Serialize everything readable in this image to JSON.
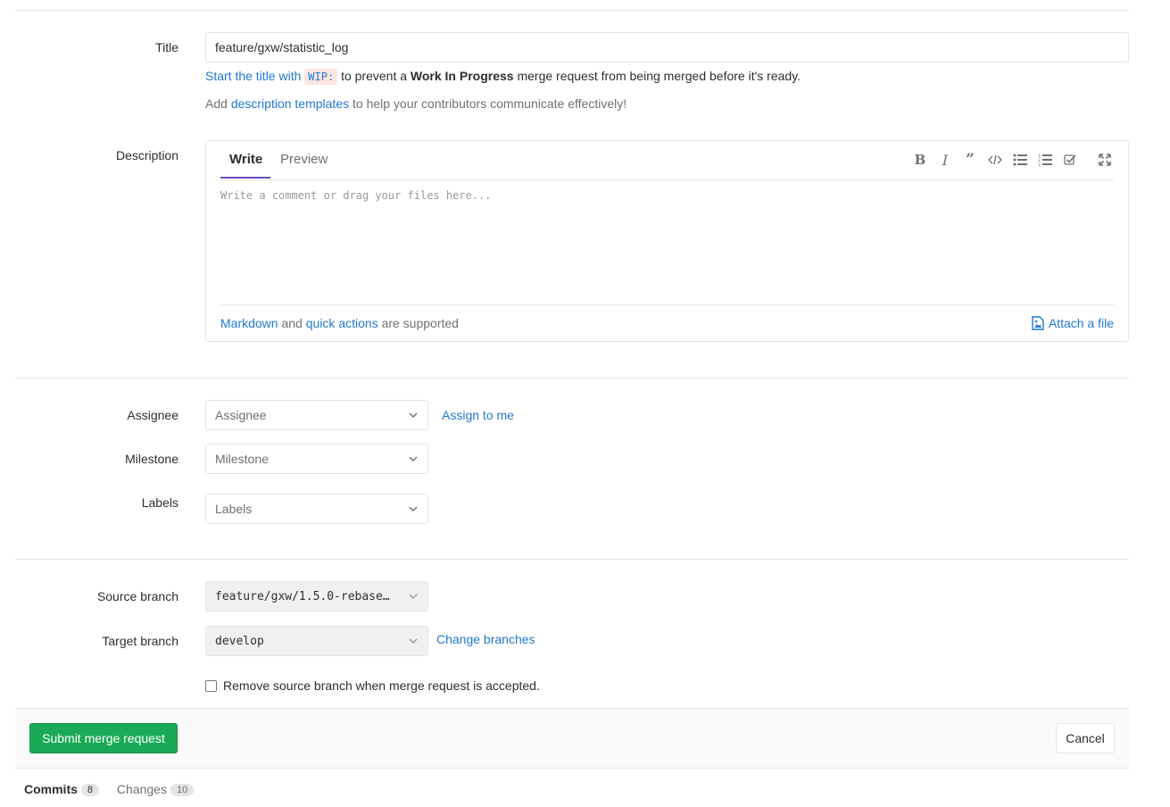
{
  "title_field": {
    "label": "Title",
    "value": "feature/gxw/statistic_log"
  },
  "wip_hint": {
    "prefix_link": "Start the title with",
    "code": "WIP:",
    "middle": "to prevent a",
    "bold": "Work In Progress",
    "suffix": "merge request from being merged before it's ready."
  },
  "template_hint": {
    "prefix": "Add",
    "link": "description templates",
    "suffix": "to help your contributors communicate effectively!"
  },
  "description": {
    "label": "Description",
    "tabs": [
      "Write",
      "Preview"
    ],
    "placeholder": "Write a comment or drag your files here...",
    "footer_link1": "Markdown",
    "footer_and": "and",
    "footer_link2": "quick actions",
    "footer_suffix": "are supported",
    "attach_label": "Attach a file",
    "toolbar": [
      "bold-icon",
      "italic-icon",
      "quote-icon",
      "code-icon",
      "bullet-list-icon",
      "numbered-list-icon",
      "task-list-icon",
      "fullscreen-icon"
    ]
  },
  "assignee": {
    "label": "Assignee",
    "value": "Assignee",
    "assign_link": "Assign to me"
  },
  "milestone": {
    "label": "Milestone",
    "value": "Milestone"
  },
  "labels": {
    "label": "Labels",
    "value": "Labels"
  },
  "source_branch": {
    "label": "Source branch",
    "value": "feature/gxw/1.5.0-rebase…"
  },
  "target_branch": {
    "label": "Target branch",
    "value": "develop",
    "change_link": "Change branches"
  },
  "remove_branch": {
    "label": "Remove source branch when merge request is accepted.",
    "checked": false
  },
  "actions": {
    "submit": "Submit merge request",
    "cancel": "Cancel"
  },
  "bottom_tabs": [
    {
      "label": "Commits",
      "count": "8"
    },
    {
      "label": "Changes",
      "count": "10"
    }
  ],
  "colors": {
    "link": "#1f78d1",
    "success": "#1aaa55",
    "tab_active": "#6b4fbb"
  }
}
